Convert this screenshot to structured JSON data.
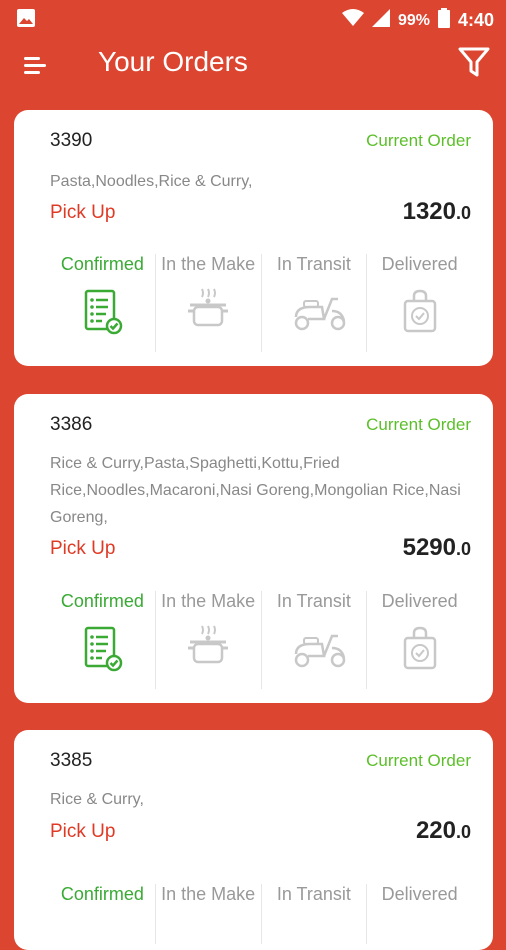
{
  "status_bar": {
    "battery_text": "99%",
    "time": "4:40"
  },
  "app_bar": {
    "title": "Your Orders"
  },
  "colors": {
    "primary": "#dc4530",
    "active_step": "#3aaa35",
    "current_order": "#5cbf2a",
    "pickup": "#e03a25",
    "inactive": "#999999"
  },
  "orders": [
    {
      "id": "3390",
      "status": "Current Order",
      "items": "Pasta,Noodles,Rice & Curry,",
      "type": "Pick Up",
      "price": "1320",
      "price_dec": ".0",
      "steps": [
        "Confirmed",
        "In the Make",
        "In Transit",
        "Delivered"
      ]
    },
    {
      "id": "3386",
      "status": "Current Order",
      "items": "Rice & Curry,Pasta,Spaghetti,Kottu,Fried Rice,Noodles,Macaroni,Nasi Goreng,Mongolian Rice,Nasi Goreng,",
      "type": "Pick Up",
      "price": "5290",
      "price_dec": ".0",
      "steps": [
        "Confirmed",
        "In the Make",
        "In Transit",
        "Delivered"
      ]
    },
    {
      "id": "3385",
      "status": "Current Order",
      "items": "Rice & Curry,",
      "type": "Pick Up",
      "price": "220",
      "price_dec": ".0",
      "steps": [
        "Confirmed",
        "In the Make",
        "In Transit",
        "Delivered"
      ]
    }
  ],
  "step_icons": [
    "checklist-icon",
    "cooking-pot-icon",
    "scooter-icon",
    "shopping-bag-check-icon"
  ]
}
